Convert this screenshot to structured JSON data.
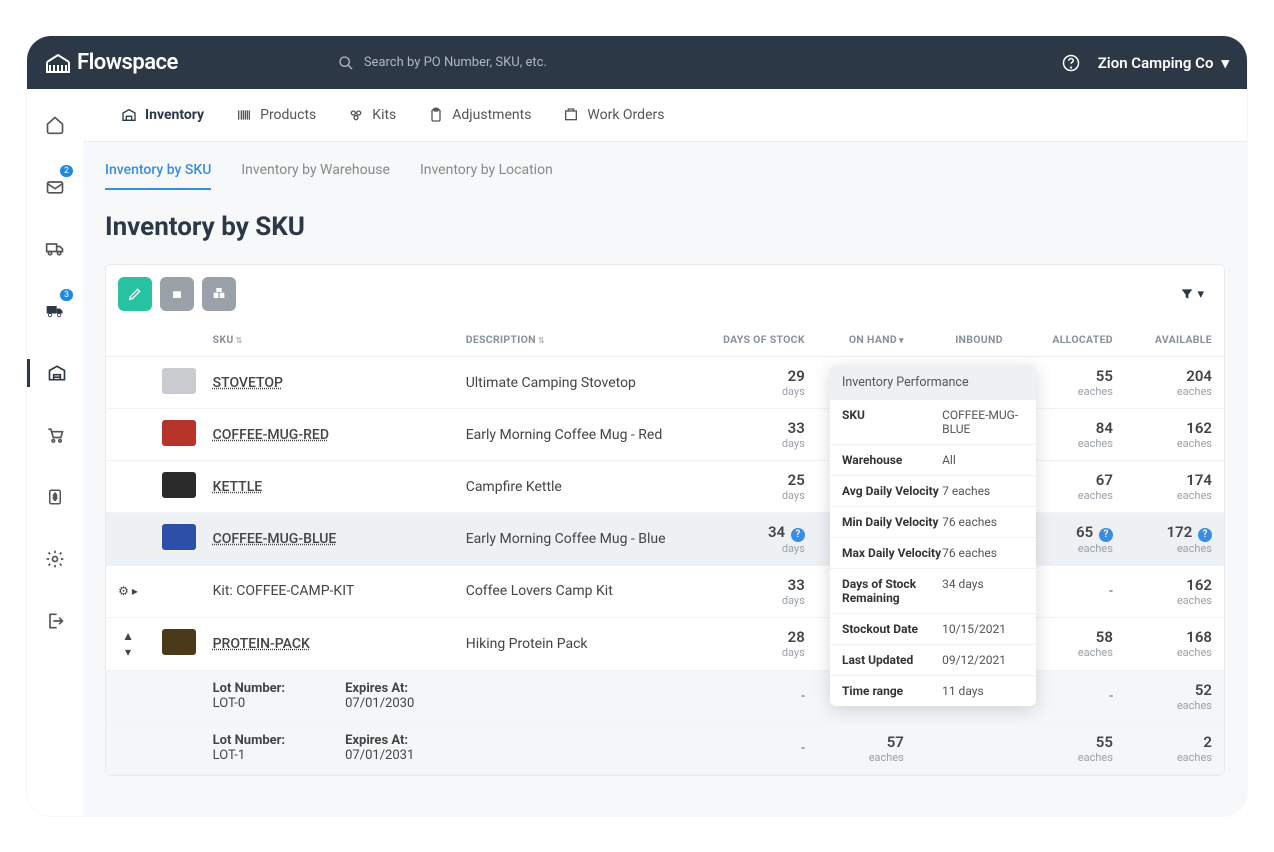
{
  "brand": "Flowspace",
  "search_placeholder": "Search by PO Number, SKU, etc.",
  "company_name": "Zion Camping Co",
  "vnav_badges": {
    "mail": "2",
    "truck": "3"
  },
  "tabs1": [
    "Inventory",
    "Products",
    "Kits",
    "Adjustments",
    "Work Orders"
  ],
  "tabs2": [
    "Inventory by SKU",
    "Inventory by Warehouse",
    "Inventory by Location"
  ],
  "page_title": "Inventory by SKU",
  "columns": {
    "sku": "SKU",
    "description": "DESCRIPTION",
    "days": "DAYS OF STOCK",
    "on_hand": "ON HAND",
    "inbound": "INBOUND",
    "allocated": "ALLOCATED",
    "available": "AVAILABLE"
  },
  "unit_days": "days",
  "unit_eaches": "eaches",
  "rows": [
    {
      "sku": "STOVETOP",
      "desc": "Ultimate Camping Stovetop",
      "days": "29",
      "on_hand": "",
      "inbound": "",
      "allocated": "55",
      "available": "204",
      "thumb": "#c9cbcf"
    },
    {
      "sku": "COFFEE-MUG-RED",
      "desc": "Early Morning Coffee Mug - Red",
      "days": "33",
      "on_hand": "",
      "inbound": "",
      "allocated": "84",
      "available": "162",
      "thumb": "#b8332a"
    },
    {
      "sku": "KETTLE",
      "desc": "Campfire Kettle",
      "days": "25",
      "on_hand": "",
      "inbound": "",
      "allocated": "67",
      "available": "174",
      "thumb": "#2b2b2b"
    },
    {
      "sku": "COFFEE-MUG-BLUE",
      "desc": "Early Morning Coffee Mug - Blue",
      "days": "34",
      "on_hand": "",
      "inbound": "",
      "allocated": "65",
      "available": "172",
      "thumb": "#2d4fa8",
      "highlight": true,
      "q_days": true,
      "q_alloc": true,
      "q_avail": true
    },
    {
      "sku": "Kit: COFFEE-CAMP-KIT",
      "desc": "Coffee Lovers Camp Kit",
      "days": "33",
      "on_hand": "",
      "inbound": "",
      "allocated": "-",
      "available": "162",
      "no_underline": true,
      "exp_icon": "kit"
    },
    {
      "sku": "PROTEIN-PACK",
      "desc": "Hiking Protein Pack",
      "days": "28",
      "on_hand": "",
      "inbound": "",
      "allocated": "58",
      "available": "168",
      "thumb": "#4a3a1a",
      "exp_icon": "lot"
    }
  ],
  "lots": [
    {
      "lot_label": "Lot Number:",
      "lot": "LOT-0",
      "exp_label": "Expires At:",
      "exp": "07/01/2030",
      "days": "-",
      "on_hand": "",
      "inbound": "",
      "allocated": "-",
      "available": "52"
    },
    {
      "lot_label": "Lot Number:",
      "lot": "LOT-1",
      "exp_label": "Expires At:",
      "exp": "07/01/2031",
      "days": "-",
      "on_hand": "57",
      "inbound": "",
      "allocated": "55",
      "available": "2"
    }
  ],
  "popover": {
    "title": "Inventory Performance",
    "rows": [
      {
        "k": "SKU",
        "v": "COFFEE-MUG-BLUE"
      },
      {
        "k": "Warehouse",
        "v": "All"
      },
      {
        "k": "Avg Daily Velocity",
        "v": "7 eaches"
      },
      {
        "k": "Min Daily Velocity",
        "v": "76 eaches"
      },
      {
        "k": "Max Daily Velocity",
        "v": "76 eaches"
      },
      {
        "k": "Days of Stock Remaining",
        "v": "34 days"
      },
      {
        "k": "Stockout Date",
        "v": "10/15/2021"
      },
      {
        "k": "Last Updated",
        "v": "09/12/2021"
      },
      {
        "k": "Time range",
        "v": "11 days"
      }
    ]
  }
}
